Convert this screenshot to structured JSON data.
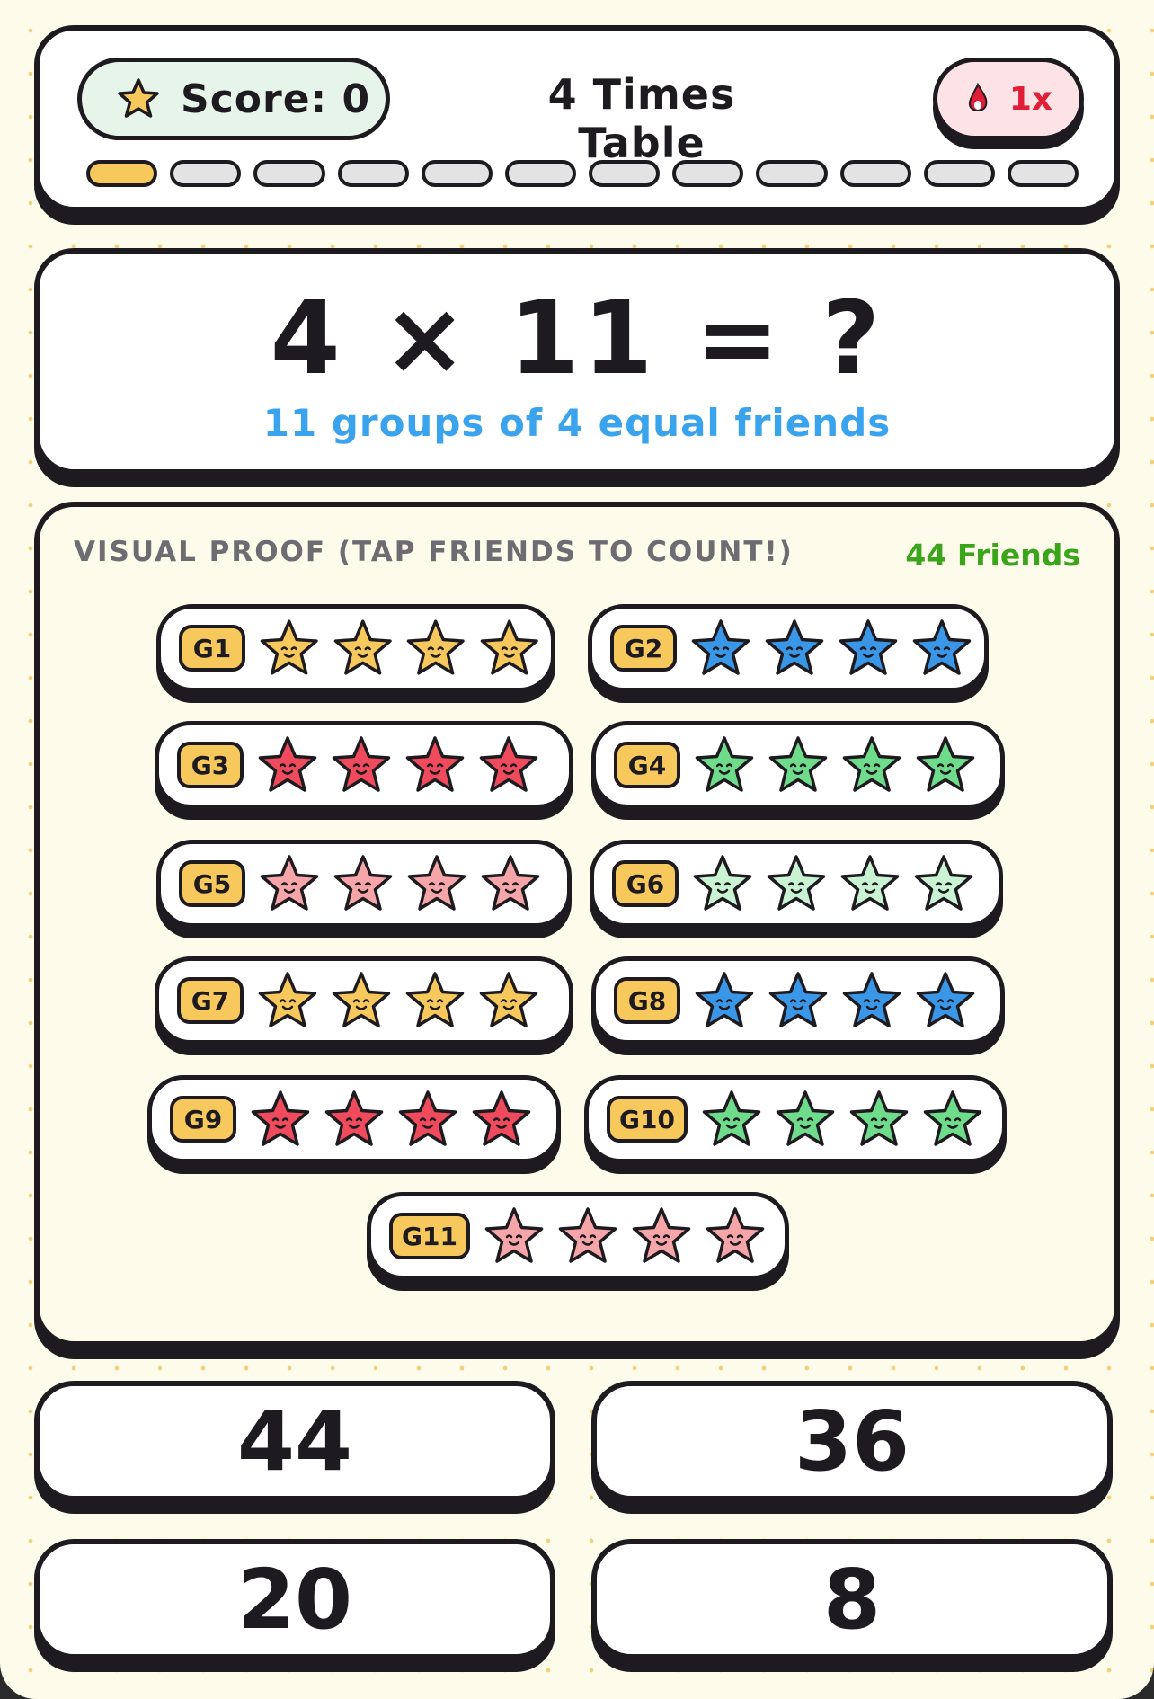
{
  "header": {
    "score_icon": "star-icon",
    "score_label": "Score: 0",
    "title": "4 Times Table",
    "streak_icon": "flame-icon",
    "streak_label": "1x",
    "progress_total": 12,
    "progress_current": 1
  },
  "question": {
    "equation": "4 × 11 = ?",
    "hint": "11 groups of 4 equal friends"
  },
  "proof": {
    "label": "VISUAL PROOF (TAP FRIENDS TO COUNT!)",
    "count_label": "44 Friends",
    "groups": [
      {
        "label": "G1",
        "color": "#f7c85b",
        "friends": 4
      },
      {
        "label": "G2",
        "color": "#3a97e8",
        "friends": 4
      },
      {
        "label": "G3",
        "color": "#ef4b5c",
        "friends": 4
      },
      {
        "label": "G4",
        "color": "#6fdc8c",
        "friends": 4
      },
      {
        "label": "G5",
        "color": "#f6a5a8",
        "friends": 4
      },
      {
        "label": "G6",
        "color": "#c9f3d2",
        "friends": 4
      },
      {
        "label": "G7",
        "color": "#f7c85b",
        "friends": 4
      },
      {
        "label": "G8",
        "color": "#3a97e8",
        "friends": 4
      },
      {
        "label": "G9",
        "color": "#ef4b5c",
        "friends": 4
      },
      {
        "label": "G10",
        "color": "#6fdc8c",
        "friends": 4
      },
      {
        "label": "G11",
        "color": "#f6a5a8",
        "friends": 4
      }
    ]
  },
  "answers": [
    {
      "value": "44"
    },
    {
      "value": "36"
    },
    {
      "value": "20"
    },
    {
      "value": "8"
    }
  ]
}
